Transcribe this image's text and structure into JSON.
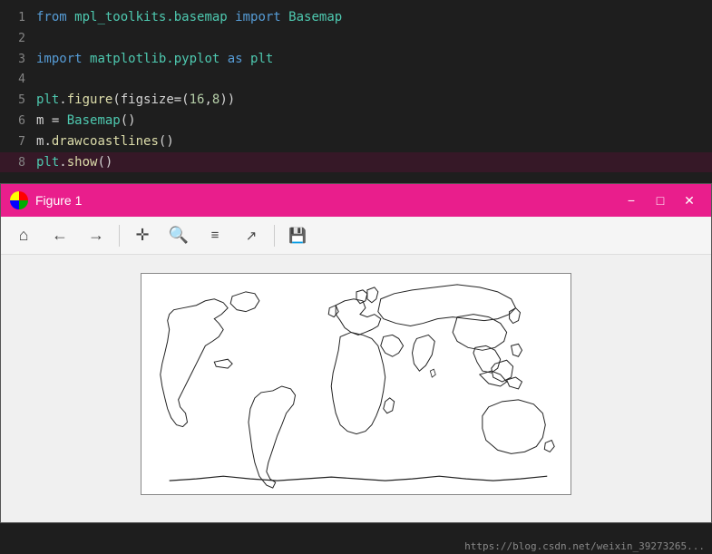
{
  "editor": {
    "lines": [
      {
        "number": 1,
        "tokens": [
          {
            "text": "from ",
            "cls": "kw"
          },
          {
            "text": "mpl_toolkits.basemap",
            "cls": "mod"
          },
          {
            "text": " import ",
            "cls": "kw"
          },
          {
            "text": "Basemap",
            "cls": "cls"
          }
        ]
      },
      {
        "number": 2,
        "tokens": []
      },
      {
        "number": 3,
        "tokens": [
          {
            "text": "import ",
            "cls": "kw"
          },
          {
            "text": "matplotlib.pyplot",
            "cls": "mod"
          },
          {
            "text": " as ",
            "cls": "kw"
          },
          {
            "text": "plt",
            "cls": "mod"
          }
        ]
      },
      {
        "number": 4,
        "tokens": []
      },
      {
        "number": 5,
        "tokens": [
          {
            "text": "plt",
            "cls": "mod"
          },
          {
            "text": ".",
            "cls": "op"
          },
          {
            "text": "figure",
            "cls": "fn"
          },
          {
            "text": "(figsize=(",
            "cls": "op"
          },
          {
            "text": "16",
            "cls": "num"
          },
          {
            "text": ",",
            "cls": "op"
          },
          {
            "text": "8",
            "cls": "num"
          },
          {
            "text": "))",
            "cls": "op"
          }
        ]
      },
      {
        "number": 6,
        "tokens": [
          {
            "text": "m",
            "cls": ""
          },
          {
            "text": " = ",
            "cls": "op"
          },
          {
            "text": "Basemap",
            "cls": "cls"
          },
          {
            "text": "()",
            "cls": "op"
          }
        ]
      },
      {
        "number": 7,
        "tokens": [
          {
            "text": "m",
            "cls": ""
          },
          {
            "text": ".",
            "cls": "op"
          },
          {
            "text": "drawcoastlines",
            "cls": "fn"
          },
          {
            "text": "()",
            "cls": "op"
          }
        ]
      },
      {
        "number": 8,
        "tokens": [
          {
            "text": "plt",
            "cls": "mod"
          },
          {
            "text": ".",
            "cls": "op"
          },
          {
            "text": "show",
            "cls": "fn"
          },
          {
            "text": "()",
            "cls": "op"
          }
        ],
        "active": true
      }
    ]
  },
  "figure": {
    "title": "Figure 1",
    "toolbar": {
      "buttons": [
        "home",
        "back",
        "forward",
        "move",
        "zoom",
        "configure",
        "edit",
        "save"
      ]
    }
  },
  "footer": {
    "url": "https://blog.csdn.net/weixin_39273265..."
  }
}
